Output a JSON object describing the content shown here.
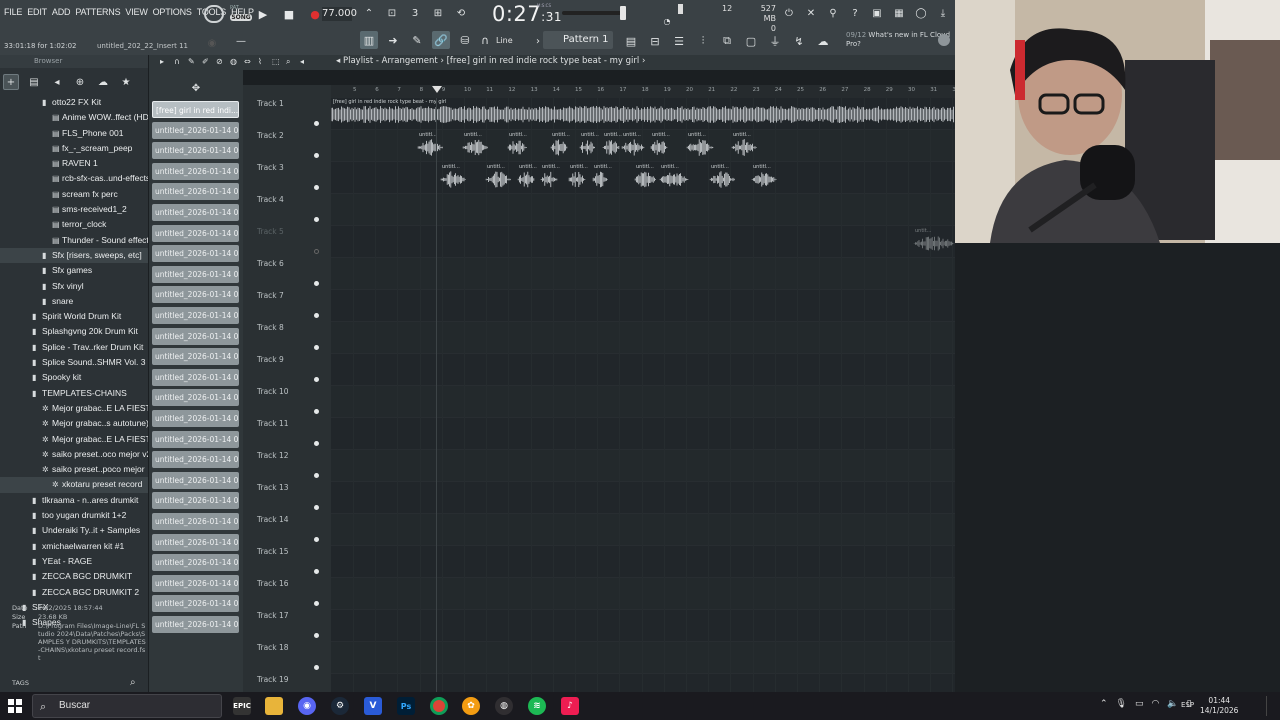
{
  "menubar": {
    "items": [
      "FILE",
      "EDIT",
      "ADD",
      "PATTERNS",
      "VIEW",
      "OPTIONS",
      "TOOLS",
      "HELP"
    ],
    "pat_song_badge_top": "PAT",
    "pat_song_badge": "SONG"
  },
  "transport": {
    "tempo": "77.000",
    "time_main": "0:27",
    "time_sub": ":31",
    "time_unit": "M:S:CS",
    "cpu": "12",
    "cpu_sub": "",
    "memory": "527 MB",
    "memory_sub": "0"
  },
  "hint_bar": {
    "hint": "33:01:18 for 1:02:02",
    "project": "untitled_202_22_Insert 11"
  },
  "toolbar2": {
    "snap_label": "Line",
    "pattern": "Pattern 1",
    "news_date": "09/12",
    "news_text": "What's new in FL Cloud Pro?"
  },
  "browser": {
    "title": "Browser",
    "items": [
      {
        "label": "otto22 FX Kit",
        "indent": 3,
        "icon": "folder-icon"
      },
      {
        "label": "Anime WOW..ffect (HD)",
        "indent": 4,
        "icon": "audio-file-icon"
      },
      {
        "label": "FLS_Phone 001",
        "indent": 4,
        "icon": "audio-file-icon"
      },
      {
        "label": "fx_-_scream_peep",
        "indent": 4,
        "icon": "audio-file-icon"
      },
      {
        "label": "RAVEN 1",
        "indent": 4,
        "icon": "audio-file-icon"
      },
      {
        "label": "rcb-sfx-cas..und-effects",
        "indent": 4,
        "icon": "audio-file-icon"
      },
      {
        "label": "scream fx perc",
        "indent": 4,
        "icon": "audio-file-icon"
      },
      {
        "label": "sms-received1_2",
        "indent": 4,
        "icon": "audio-file-icon"
      },
      {
        "label": "terror_clock",
        "indent": 4,
        "icon": "audio-file-icon"
      },
      {
        "label": "Thunder - Sound effect",
        "indent": 4,
        "icon": "audio-file-icon"
      },
      {
        "label": "Sfx [risers, sweeps, etc]",
        "indent": 3,
        "icon": "folder-icon",
        "sel": true
      },
      {
        "label": "Sfx games",
        "indent": 3,
        "icon": "folder-icon"
      },
      {
        "label": "Sfx vinyl",
        "indent": 3,
        "icon": "folder-icon"
      },
      {
        "label": "snare",
        "indent": 3,
        "icon": "folder-icon"
      },
      {
        "label": "Spirit World Drum Kit",
        "indent": 2,
        "icon": "folder-icon"
      },
      {
        "label": "Splashgvng 20k Drum Kit",
        "indent": 2,
        "icon": "folder-icon"
      },
      {
        "label": "Splice - Trav..rker Drum Kit",
        "indent": 2,
        "icon": "folder-icon"
      },
      {
        "label": "Splice Sound..SHMR Vol. 3",
        "indent": 2,
        "icon": "folder-icon"
      },
      {
        "label": "Spooky kit",
        "indent": 2,
        "icon": "folder-icon"
      },
      {
        "label": "TEMPLATES-CHAINS",
        "indent": 2,
        "icon": "folder-icon"
      },
      {
        "label": "Mejor grabac..E LA FIESTA",
        "indent": 3,
        "icon": "preset-icon"
      },
      {
        "label": "Mejor grabac..s autotune)",
        "indent": 3,
        "icon": "preset-icon"
      },
      {
        "label": "Mejor grabac..E LA FIESTA",
        "indent": 3,
        "icon": "preset-icon"
      },
      {
        "label": "saiko preset..oco mejor v2",
        "indent": 3,
        "icon": "preset-icon"
      },
      {
        "label": "saiko preset..poco mejor",
        "indent": 3,
        "icon": "preset-icon"
      },
      {
        "label": "xkotaru preset record",
        "indent": 4,
        "icon": "preset-icon",
        "sel": true
      },
      {
        "label": "tlkraama - n..ares drumkit",
        "indent": 2,
        "icon": "folder-icon"
      },
      {
        "label": "too yugan drumkit 1+2",
        "indent": 2,
        "icon": "folder-icon"
      },
      {
        "label": "Underaiki Ty..it + Samples",
        "indent": 2,
        "icon": "folder-icon"
      },
      {
        "label": "xmichaelwarren kit #1",
        "indent": 2,
        "icon": "folder-icon"
      },
      {
        "label": "YEat - RAGE",
        "indent": 2,
        "icon": "folder-icon"
      },
      {
        "label": "ZECCA BGC DRUMKIT",
        "indent": 2,
        "icon": "folder-icon"
      },
      {
        "label": "ZECCA BGC DRUMKIT 2",
        "indent": 2,
        "icon": "folder-icon"
      },
      {
        "label": "SFX",
        "indent": 1,
        "icon": "folder-icon"
      },
      {
        "label": "Shapes",
        "indent": 1,
        "icon": "folder-icon"
      }
    ],
    "info": {
      "date_key": "Date",
      "date": "26/2/2025 18:57:44",
      "size_key": "Size",
      "size": "23.68 KB",
      "path_key": "Path",
      "path": "D:\\Program Files\\Image-Line\\FL Studio 2024\\Data\\Patches\\Packs\\SAMPLES Y DRUMKITS\\TEMPLATES-CHAINS\\xkotaru preset record.fst"
    },
    "tags_label": "TAGS"
  },
  "picker": {
    "clips": [
      "[free] girl in red  indi...",
      "untitled_2026-01-14 00-...",
      "untitled_2026-01-14 00-...",
      "untitled_2026-01-14 00-...",
      "untitled_2026-01-14 01-...",
      "untitled_2026-01-14 01-...",
      "untitled_2026-01-14 01-...",
      "untitled_2026-01-14 01-...",
      "untitled_2026-01-14 01-...",
      "untitled_2026-01-14 01-...",
      "untitled_2026-01-14 01-...",
      "untitled_2026-01-14 01-...",
      "untitled_2026-01-14 01-...",
      "untitled_2026-01-14 01-...",
      "untitled_2026-01-14 01-...",
      "untitled_2026-01-14 01-...",
      "untitled_2026-01-14 01-...",
      "untitled_2026-01-14 01-...",
      "untitled_2026-01-14 01-...",
      "untitled_2026-01-14 01-...",
      "untitled_2026-01-14 01-...",
      "untitled_2026-01-14 01-...",
      "untitled_2026-01-14 01-...",
      "untitled_2026-01-14 01-...",
      "untitled_2026-01-14 01-...",
      "untitled_2026-01-14 01-..."
    ]
  },
  "playlist": {
    "title": "Playlist - Arrangement",
    "breadcrumb": "[free] girl in red  indie rock type beat - my girl",
    "ruler": [
      "5",
      "6",
      "7",
      "8",
      "9",
      "10",
      "11",
      "12",
      "13",
      "14",
      "15",
      "16",
      "17",
      "18",
      "19",
      "20",
      "21",
      "22",
      "23",
      "24",
      "25",
      "26",
      "27",
      "28",
      "29",
      "30",
      "31",
      "32"
    ],
    "tracks": [
      "Track 1",
      "Track 2",
      "Track 3",
      "Track 4",
      "Track 5",
      "Track 6",
      "Track 7",
      "Track 8",
      "Track 9",
      "Track 10",
      "Track 11",
      "Track 12",
      "Track 13",
      "Track 14",
      "Track 15",
      "Track 16",
      "Track 17",
      "Track 18",
      "Track 19"
    ],
    "track1_clip": "[free] girl in red  indie rock type beat - my girl",
    "clip_short": "untitl...",
    "track5_clip": "untit...",
    "track5_clip_b": "untitl.. Ins"
  },
  "taskbar": {
    "search_placeholder": "Buscar",
    "lang": "ESP",
    "time": "01:44",
    "date": "14/1/2026"
  },
  "colors": {
    "accent_red": "#e03030",
    "clip_gray": "#8e979b",
    "bg": "#21262a"
  }
}
